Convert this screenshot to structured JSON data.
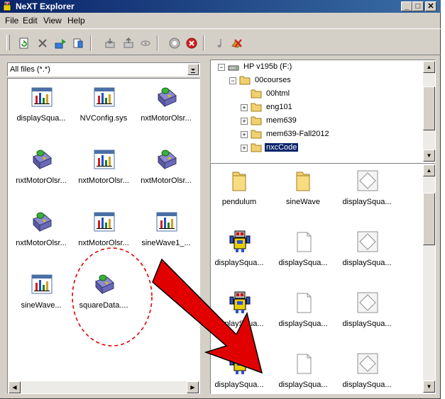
{
  "window": {
    "title": "NeXT Explorer",
    "controls": {
      "minimize": "_",
      "maximize": "□",
      "close": "✕"
    }
  },
  "menu": [
    "File",
    "Edit",
    "View",
    "Help"
  ],
  "toolbar": {
    "icons": [
      "refresh-icon",
      "delete-icon",
      "upload-icon",
      "properties-icon",
      "download-icon",
      "export-icon",
      "link-icon",
      "play-icon",
      "stop-icon",
      "music-icon",
      "erase-icon"
    ]
  },
  "filter": {
    "value": "All files (*.*)"
  },
  "nxt_files": [
    {
      "name": "displaySqua...",
      "icon": "chart-file-icon"
    },
    {
      "name": "NVConfig.sys",
      "icon": "chart-file-icon"
    },
    {
      "name": "nxtMotorOlsr...",
      "icon": "program-book-icon"
    },
    {
      "name": "nxtMotorOlsr...",
      "icon": "program-book-icon"
    },
    {
      "name": "nxtMotorOlsr...",
      "icon": "chart-file-icon"
    },
    {
      "name": "nxtMotorOlsr...",
      "icon": "program-book-icon"
    },
    {
      "name": "nxtMotorOlsr...",
      "icon": "program-book-icon"
    },
    {
      "name": "nxtMotorOlsr...",
      "icon": "chart-file-icon"
    },
    {
      "name": "sineWave1_...",
      "icon": "chart-file-icon"
    },
    {
      "name": "sineWave...",
      "icon": "chart-file-icon"
    },
    {
      "name": "squareData....",
      "icon": "program-book-icon"
    }
  ],
  "tree": [
    {
      "label": "HP v195b (F:)",
      "type": "drive",
      "level": 0,
      "toggle": "−"
    },
    {
      "label": "00courses",
      "type": "folder",
      "level": 1,
      "toggle": "−"
    },
    {
      "label": "00html",
      "type": "folder",
      "level": 2,
      "toggle": ""
    },
    {
      "label": "eng101",
      "type": "folder",
      "level": 2,
      "toggle": "+"
    },
    {
      "label": "mem639",
      "type": "folder",
      "level": 2,
      "toggle": "+"
    },
    {
      "label": "mem639-Fall2012",
      "type": "folder",
      "level": 2,
      "toggle": "+"
    },
    {
      "label": "nxcCode",
      "type": "folder",
      "level": 2,
      "toggle": "+",
      "selected": true
    }
  ],
  "pc_files": [
    {
      "name": "pendulum",
      "icon": "folder-icon"
    },
    {
      "name": "sineWave",
      "icon": "folder-icon"
    },
    {
      "name": "displaySqua...",
      "icon": "diamond-file-icon"
    },
    {
      "name": "displaySqua...",
      "icon": "robot-icon"
    },
    {
      "name": "displaySqua...",
      "icon": "blank-file-icon"
    },
    {
      "name": "displaySqua...",
      "icon": "diamond-file-icon"
    },
    {
      "name": "displaySqua...",
      "icon": "robot-icon"
    },
    {
      "name": "displaySqua...",
      "icon": "blank-file-icon"
    },
    {
      "name": "displaySqua...",
      "icon": "diamond-file-icon"
    },
    {
      "name": "displaySqua...",
      "icon": "robot-icon"
    },
    {
      "name": "displaySqua...",
      "icon": "blank-file-icon"
    },
    {
      "name": "displaySqua...",
      "icon": "diamond-file-icon"
    }
  ],
  "annotation": {
    "circle_color": "#e00000",
    "arrow_color": "#e00000"
  }
}
